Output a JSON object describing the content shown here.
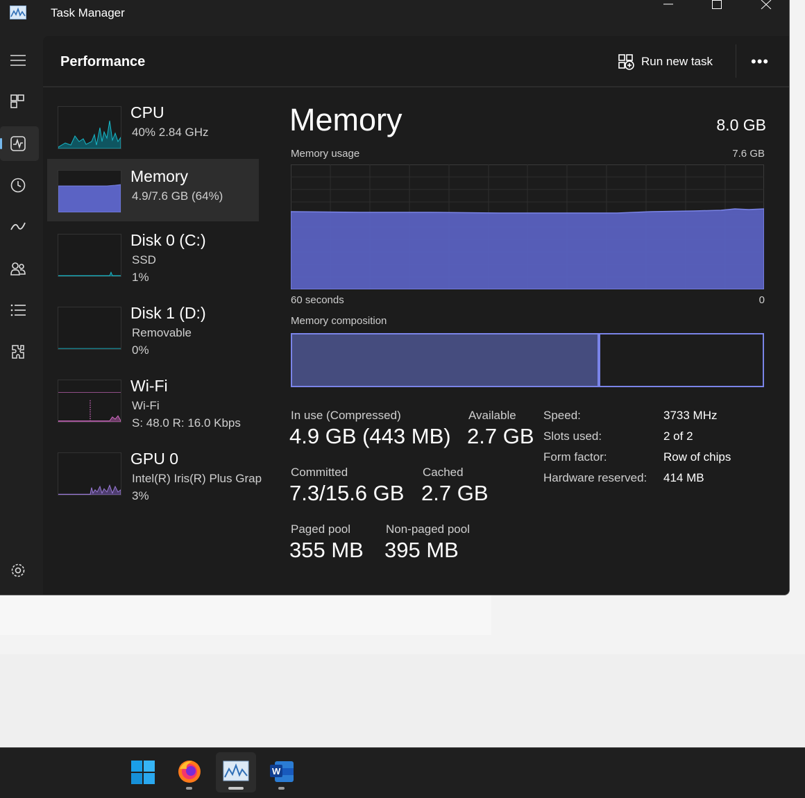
{
  "window": {
    "title": "Task Manager"
  },
  "header": {
    "title": "Performance",
    "run_new_task": "Run new task",
    "more": "•••"
  },
  "nav": {
    "items": [
      "menu-icon",
      "processes-icon",
      "performance-icon",
      "app-history-icon",
      "startup-apps-icon",
      "users-icon",
      "details-icon",
      "services-icon"
    ],
    "settings": "settings-icon",
    "active": "performance-icon"
  },
  "resources": [
    {
      "title": "CPU",
      "sub1": "40%  2.84 GHz",
      "sub2": ""
    },
    {
      "title": "Memory",
      "sub1": "4.9/7.6 GB (64%)",
      "sub2": ""
    },
    {
      "title": "Disk 0 (C:)",
      "sub1": "SSD",
      "sub2": "1%"
    },
    {
      "title": "Disk 1 (D:)",
      "sub1": "Removable",
      "sub2": "0%"
    },
    {
      "title": "Wi-Fi",
      "sub1": "Wi-Fi",
      "sub2": "S: 48.0  R: 16.0 Kbps"
    },
    {
      "title": "GPU 0",
      "sub1": "Intel(R) Iris(R) Plus Graphics",
      "sub2": "3%"
    }
  ],
  "memory": {
    "title": "Memory",
    "total": "8.0 GB",
    "usage_label": "Memory usage",
    "usage_max": "7.6 GB",
    "axis_left": "60 seconds",
    "axis_right": "0",
    "composition_label": "Memory composition",
    "composition_used_fraction": 0.65,
    "stats": {
      "in_use_label": "In use (Compressed)",
      "in_use": "4.9 GB (443 MB)",
      "available_label": "Available",
      "available": "2.7 GB",
      "committed_label": "Committed",
      "committed": "7.3/15.6 GB",
      "cached_label": "Cached",
      "cached": "2.7 GB",
      "paged_label": "Paged pool",
      "paged": "355 MB",
      "nonpaged_label": "Non-paged pool",
      "nonpaged": "395 MB"
    },
    "specs": [
      {
        "key": "Speed:",
        "value": "3733 MHz"
      },
      {
        "key": "Slots used:",
        "value": "2 of 2"
      },
      {
        "key": "Form factor:",
        "value": "Row of chips"
      },
      {
        "key": "Hardware reserved:",
        "value": "414 MB"
      }
    ]
  },
  "colors": {
    "memory_fill": "#5b63c4",
    "memory_line": "#7a84e8",
    "cpu": "#18b9c9",
    "wifi": "#d86ec9",
    "gpu": "#9b7ad8",
    "disk": "#18b9c9"
  },
  "taskbar": {
    "apps": [
      "windows-start-icon",
      "firefox-icon",
      "task-manager-icon",
      "word-icon"
    ],
    "active": "task-manager-icon"
  }
}
